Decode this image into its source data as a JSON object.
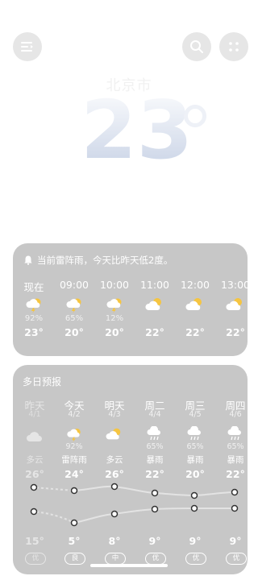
{
  "city": "北京市",
  "current_temp": "23",
  "hourly_card": {
    "alert": "当前雷阵雨，今天比昨天低2度。",
    "hours": [
      {
        "time": "现在",
        "icon": "thunder-icon",
        "precip": "92%",
        "temp": "23°"
      },
      {
        "time": "09:00",
        "icon": "thunder-icon",
        "precip": "65%",
        "temp": "20°"
      },
      {
        "time": "10:00",
        "icon": "thunder-icon",
        "precip": "12%",
        "temp": "20°"
      },
      {
        "time": "11:00",
        "icon": "partly-cloudy-icon",
        "precip": "",
        "temp": "22°"
      },
      {
        "time": "12:00",
        "icon": "partly-cloudy-icon",
        "precip": "",
        "temp": "22°"
      },
      {
        "time": "13:00",
        "icon": "partly-cloudy-icon",
        "precip": "",
        "temp": "22°"
      }
    ]
  },
  "daily_card": {
    "title": "多日预报",
    "days": [
      {
        "day": "昨天",
        "date": "4/1",
        "icon": "cloudy-icon",
        "precip": "",
        "weather": "多云",
        "high": "26°",
        "low": "15°",
        "aqi": "优"
      },
      {
        "day": "今天",
        "date": "4/2",
        "icon": "thunder-icon",
        "precip": "92%",
        "weather": "雷阵雨",
        "high": "24°",
        "low": "5°",
        "aqi": "良"
      },
      {
        "day": "明天",
        "date": "4/3",
        "icon": "partly-cloudy-icon",
        "precip": "",
        "weather": "多云",
        "high": "26°",
        "low": "8°",
        "aqi": "中"
      },
      {
        "day": "周二",
        "date": "4/4",
        "icon": "rain-icon",
        "precip": "65%",
        "weather": "暴雨",
        "high": "22°",
        "low": "9°",
        "aqi": "优"
      },
      {
        "day": "周三",
        "date": "4/5",
        "icon": "rain-icon",
        "precip": "65%",
        "weather": "暴雨",
        "high": "20°",
        "low": "9°",
        "aqi": "优"
      },
      {
        "day": "周四",
        "date": "4/6",
        "icon": "rain-icon",
        "precip": "65%",
        "weather": "暴雨",
        "high": "22°",
        "low": "9°",
        "aqi": "优"
      }
    ]
  },
  "colors": {
    "card": "#c7c7c7",
    "text": "#ffffff",
    "accent_sun": "#f5c542"
  }
}
